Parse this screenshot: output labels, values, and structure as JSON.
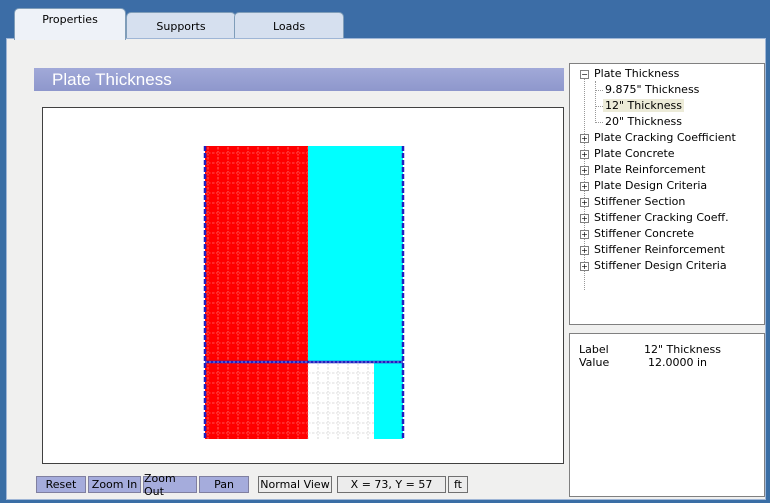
{
  "tabs": [
    {
      "label": "Properties",
      "active": true
    },
    {
      "label": "Supports",
      "active": false
    },
    {
      "label": "Loads",
      "active": false
    }
  ],
  "header": {
    "title": "Plate Thickness"
  },
  "tree": {
    "root": {
      "label": "Plate Thickness",
      "expanded": true,
      "children": [
        "9.875\" Thickness",
        "12\" Thickness",
        "20\" Thickness"
      ],
      "selected_child": "12\" Thickness"
    },
    "items": [
      "Plate Cracking Coefficient",
      "Plate Concrete",
      "Plate Reinforcement",
      "Plate Design Criteria",
      "Stiffener Section",
      "Stiffener Cracking Coeff.",
      "Stiffener Concrete",
      "Stiffener Reinforcement",
      "Stiffener Design Criteria"
    ]
  },
  "details": {
    "label_key": "Label",
    "label_value": "12\" Thickness",
    "value_key": "Value",
    "value_value": "12.0000 in"
  },
  "statusbar": {
    "reset": "Reset",
    "zoom_in": "Zoom In",
    "zoom_out": "Zoom Out",
    "pan": "Pan",
    "view": "Normal View",
    "coords": "X = 73, Y = 57",
    "units": "ft"
  },
  "colors": {
    "red_zone": "#ff0000",
    "cyan_zone": "#00ffff",
    "white_zone": "#ffffff",
    "header": "#9aa2d4",
    "tab_area": "#3c6da6"
  }
}
